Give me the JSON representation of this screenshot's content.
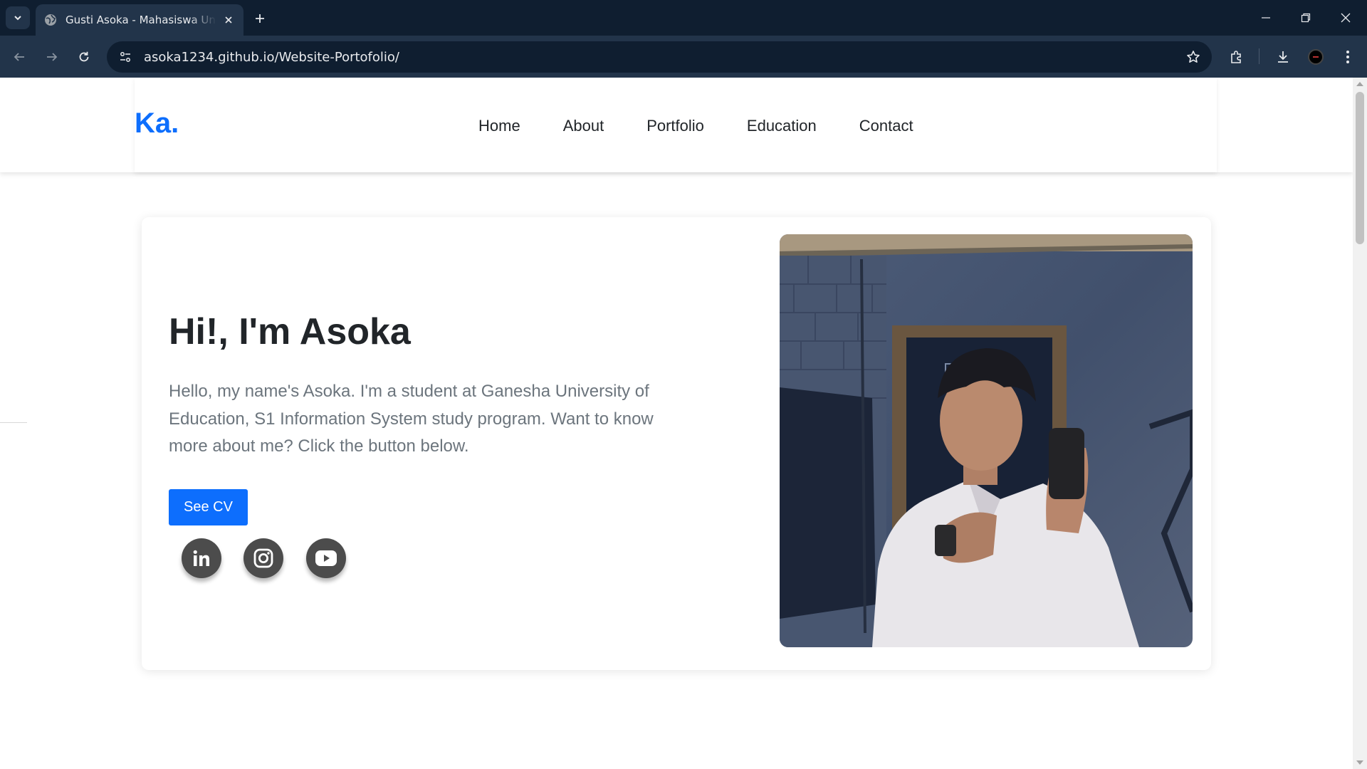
{
  "browser": {
    "tab_title": "Gusti Asoka - Mahasiswa Undiksha",
    "url": "asoka1234.github.io/Website-Portofolio/"
  },
  "site": {
    "logo": "Ka.",
    "nav": [
      "Home",
      "About",
      "Portfolio",
      "Education",
      "Contact"
    ],
    "hero": {
      "title": "Hi!, I'm Asoka",
      "text": "Hello, my name's Asoka. I'm a student at Ganesha University of Education, S1 Information System study program. Want to know more about me? Click the button below.",
      "cv_button": "See CV"
    },
    "social_icons": [
      "linkedin-icon",
      "instagram-icon",
      "youtube-icon"
    ]
  },
  "colors": {
    "accent": "#0d6efd",
    "browser_dark": "#0f1e30",
    "browser_toolbar": "#22344a",
    "heading": "#212529",
    "body_text": "#6c757d",
    "social_bg": "#4c4c4c"
  }
}
